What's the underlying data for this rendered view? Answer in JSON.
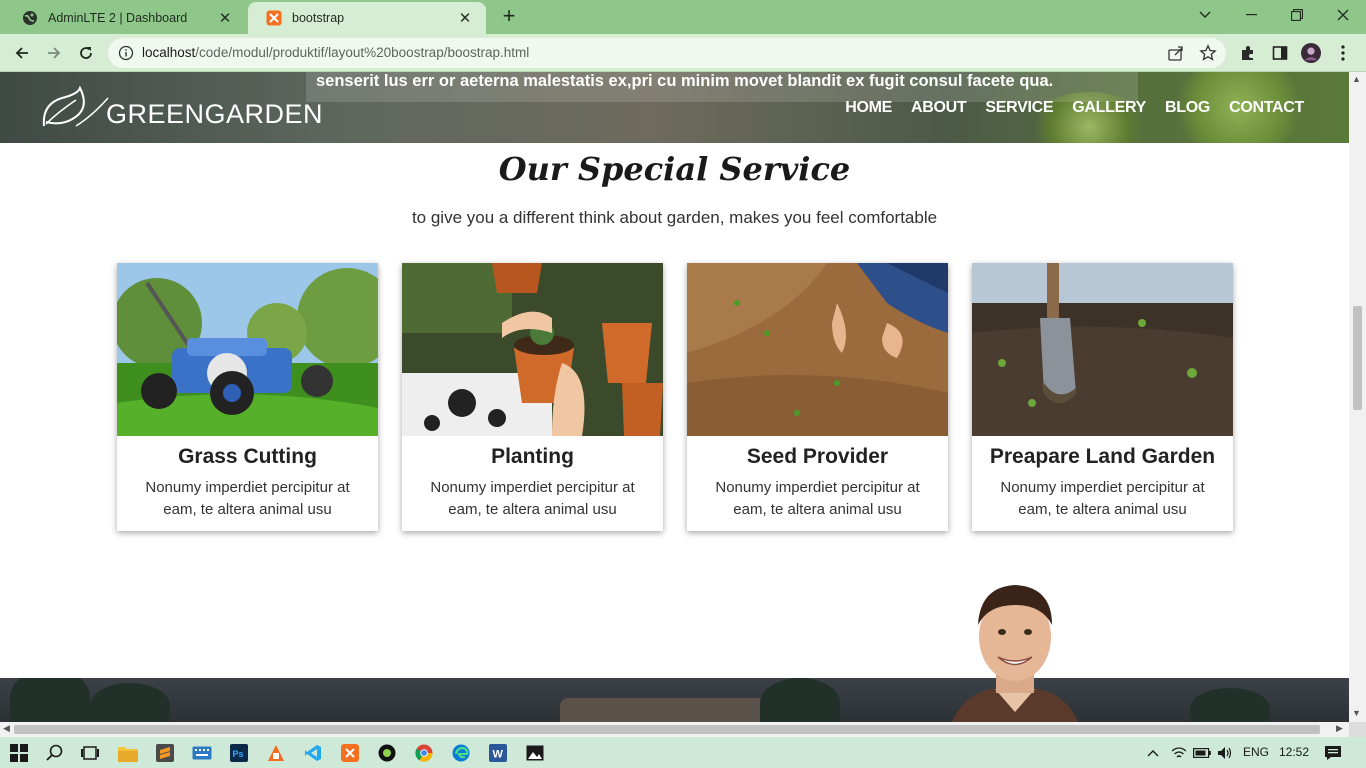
{
  "browser": {
    "tabs": [
      {
        "label": "AdminLTE 2 | Dashboard",
        "icon": "globe-icon",
        "active": false
      },
      {
        "label": "bootstrap",
        "icon": "xampp-icon",
        "active": true
      }
    ],
    "address": {
      "host": "localhost",
      "path": "/code/modul/produktif/layout%20boostrap/boostrap.html"
    }
  },
  "page": {
    "hero_overlay_text": "senserit lus err or aeterna malestatis ex,pri cu minim movet blandit ex fugit consul facete qua.",
    "logo_text": "GREENGARDEN",
    "nav": [
      "HOME",
      "ABOUT",
      "SERVICE",
      "GALLERY",
      "BLOG",
      "CONTACT"
    ],
    "section_title": "Our Special Service",
    "section_subtitle": "to give you a different think about garden, makes you feel comfortable",
    "services": [
      {
        "title": "Grass Cutting",
        "text": "Nonumy imperdiet percipitur at eam, te altera animal usu",
        "image": "lawn-mower-photo"
      },
      {
        "title": "Planting",
        "text": "Nonumy imperdiet percipitur at eam, te altera animal usu",
        "image": "potted-plant-photo"
      },
      {
        "title": "Seed Provider",
        "text": "Nonumy imperdiet percipitur at eam, te altera animal usu",
        "image": "soil-seeding-photo"
      },
      {
        "title": "Preapare Land Garden",
        "text": "Nonumy imperdiet percipitur at eam, te altera animal usu",
        "image": "garden-spade-photo"
      }
    ]
  },
  "taskbar": {
    "language": "ENG",
    "time": "12:52"
  }
}
